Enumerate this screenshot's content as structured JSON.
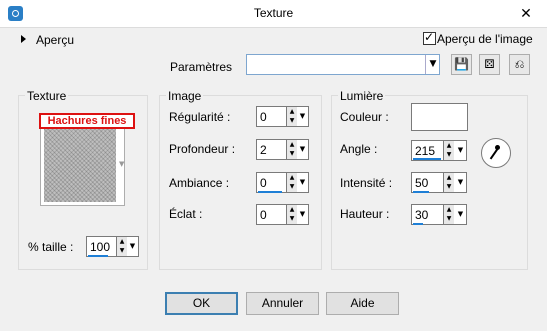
{
  "window": {
    "title": "Texture",
    "close_glyph": "✕",
    "icon": "app-icon"
  },
  "preview": {
    "collapse_label": "Aperçu",
    "checkbox_label": "Aperçu de l'image",
    "checked": true
  },
  "presets": {
    "label": "Paramètres",
    "value": "",
    "arrow": "▼",
    "save_icon": "💾",
    "random_icon": "⚄",
    "reset_icon": "⎌"
  },
  "texture": {
    "group_label": "Texture",
    "selected_name": "Hachures fines",
    "size_label": "% taille :",
    "size_value": "100"
  },
  "image": {
    "group_label": "Image",
    "regularity_label": "Régularité :",
    "regularity_value": "0",
    "depth_label": "Profondeur :",
    "depth_value": "2",
    "ambience_label": "Ambiance :",
    "ambience_value": "0",
    "shine_label": "Éclat :",
    "shine_value": "0"
  },
  "light": {
    "group_label": "Lumière",
    "color_label": "Couleur :",
    "color_value": "#ffffff",
    "angle_label": "Angle :",
    "angle_value": "215",
    "intensity_label": "Intensité :",
    "intensity_value": "50",
    "height_label": "Hauteur :",
    "height_value": "30"
  },
  "buttons": {
    "ok": "OK",
    "cancel": "Annuler",
    "help": "Aide"
  },
  "colors": {
    "accent": "#1e7fd6",
    "highlight_red": "#dd1111"
  }
}
